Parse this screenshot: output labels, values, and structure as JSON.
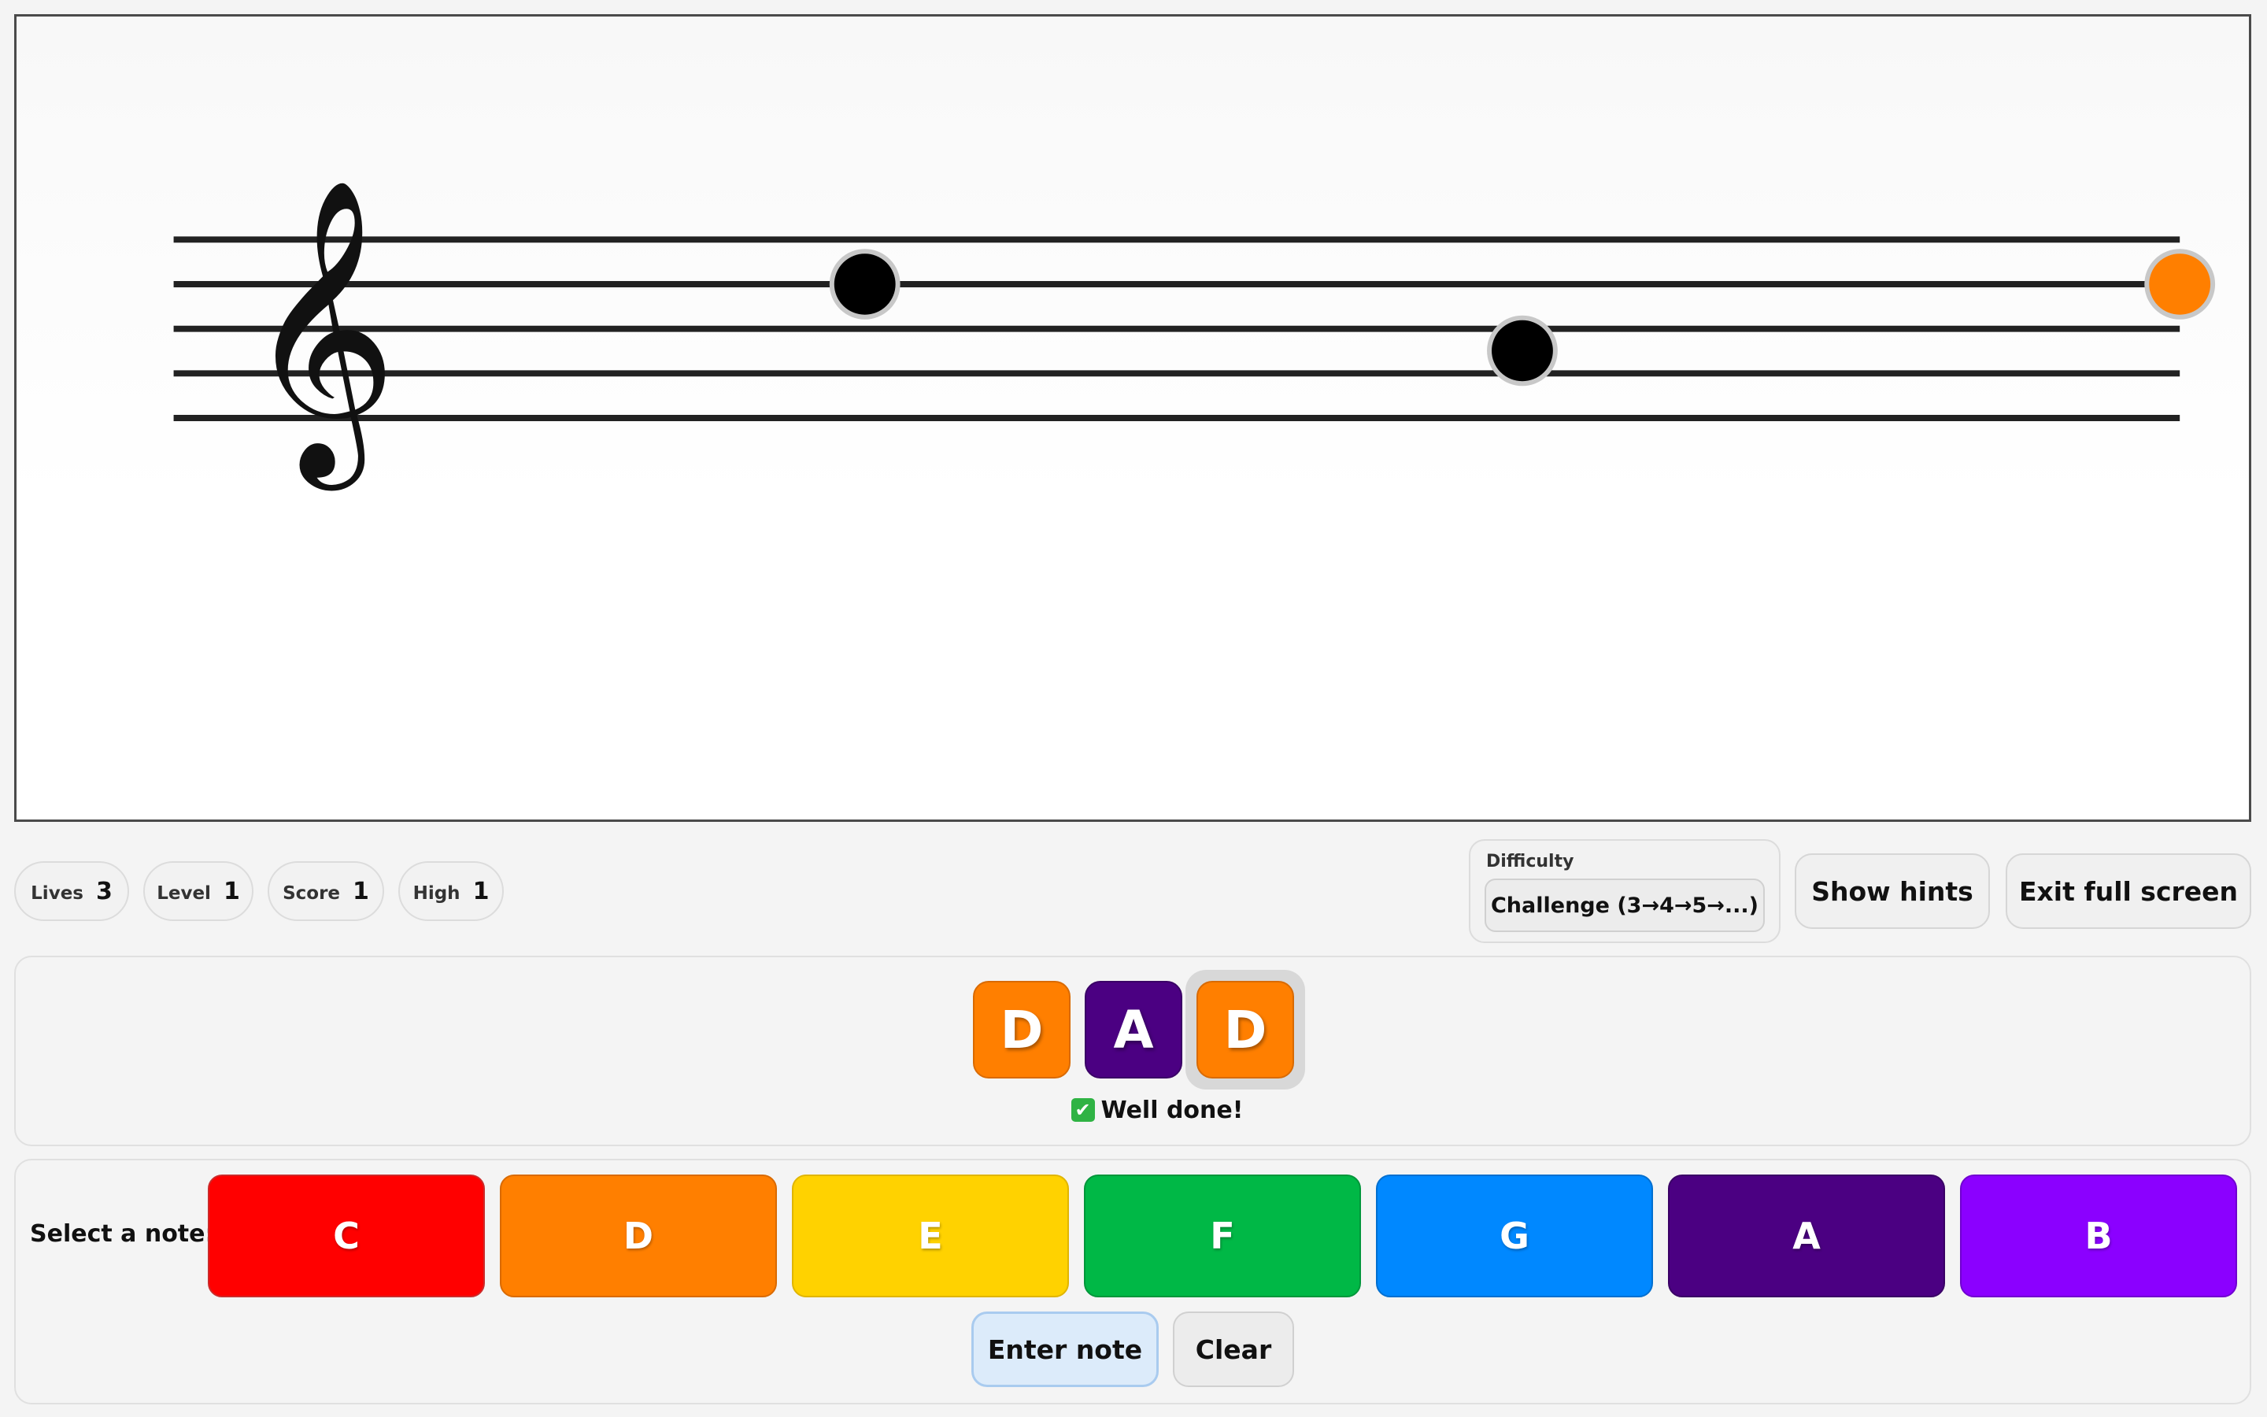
{
  "stats": [
    {
      "label": "Lives",
      "value": "3"
    },
    {
      "label": "Level",
      "value": "1"
    },
    {
      "label": "Score",
      "value": "1"
    },
    {
      "label": "High",
      "value": "1"
    }
  ],
  "difficulty": {
    "label": "Difficulty",
    "selected": "Challenge (3→4→5→...)"
  },
  "buttons": {
    "show_hints": "Show hints",
    "exit_full_screen": "Exit full screen",
    "enter_note": "Enter note",
    "clear": "Clear"
  },
  "staff": {
    "clef": "𝄞",
    "notes": [
      {
        "name": "D",
        "color": "#000000",
        "state": "past"
      },
      {
        "name": "A",
        "color": "#000000",
        "state": "past"
      },
      {
        "name": "D",
        "color": "#ff7f00",
        "state": "current"
      }
    ]
  },
  "sequence": {
    "tiles": [
      {
        "letter": "D",
        "color": "#ff7f00"
      },
      {
        "letter": "A",
        "color": "#4b0082"
      },
      {
        "letter": "D",
        "color": "#ff7f00"
      }
    ],
    "feedback_icon": "✔",
    "feedback": "Well done!"
  },
  "picker": {
    "label": "Select a note:",
    "notes": [
      {
        "letter": "C",
        "color": "#ff0000"
      },
      {
        "letter": "D",
        "color": "#ff7f00"
      },
      {
        "letter": "E",
        "color": "#ffd200"
      },
      {
        "letter": "F",
        "color": "#00b846"
      },
      {
        "letter": "G",
        "color": "#0088ff"
      },
      {
        "letter": "A",
        "color": "#4b0082"
      },
      {
        "letter": "B",
        "color": "#8b00ff"
      }
    ]
  }
}
